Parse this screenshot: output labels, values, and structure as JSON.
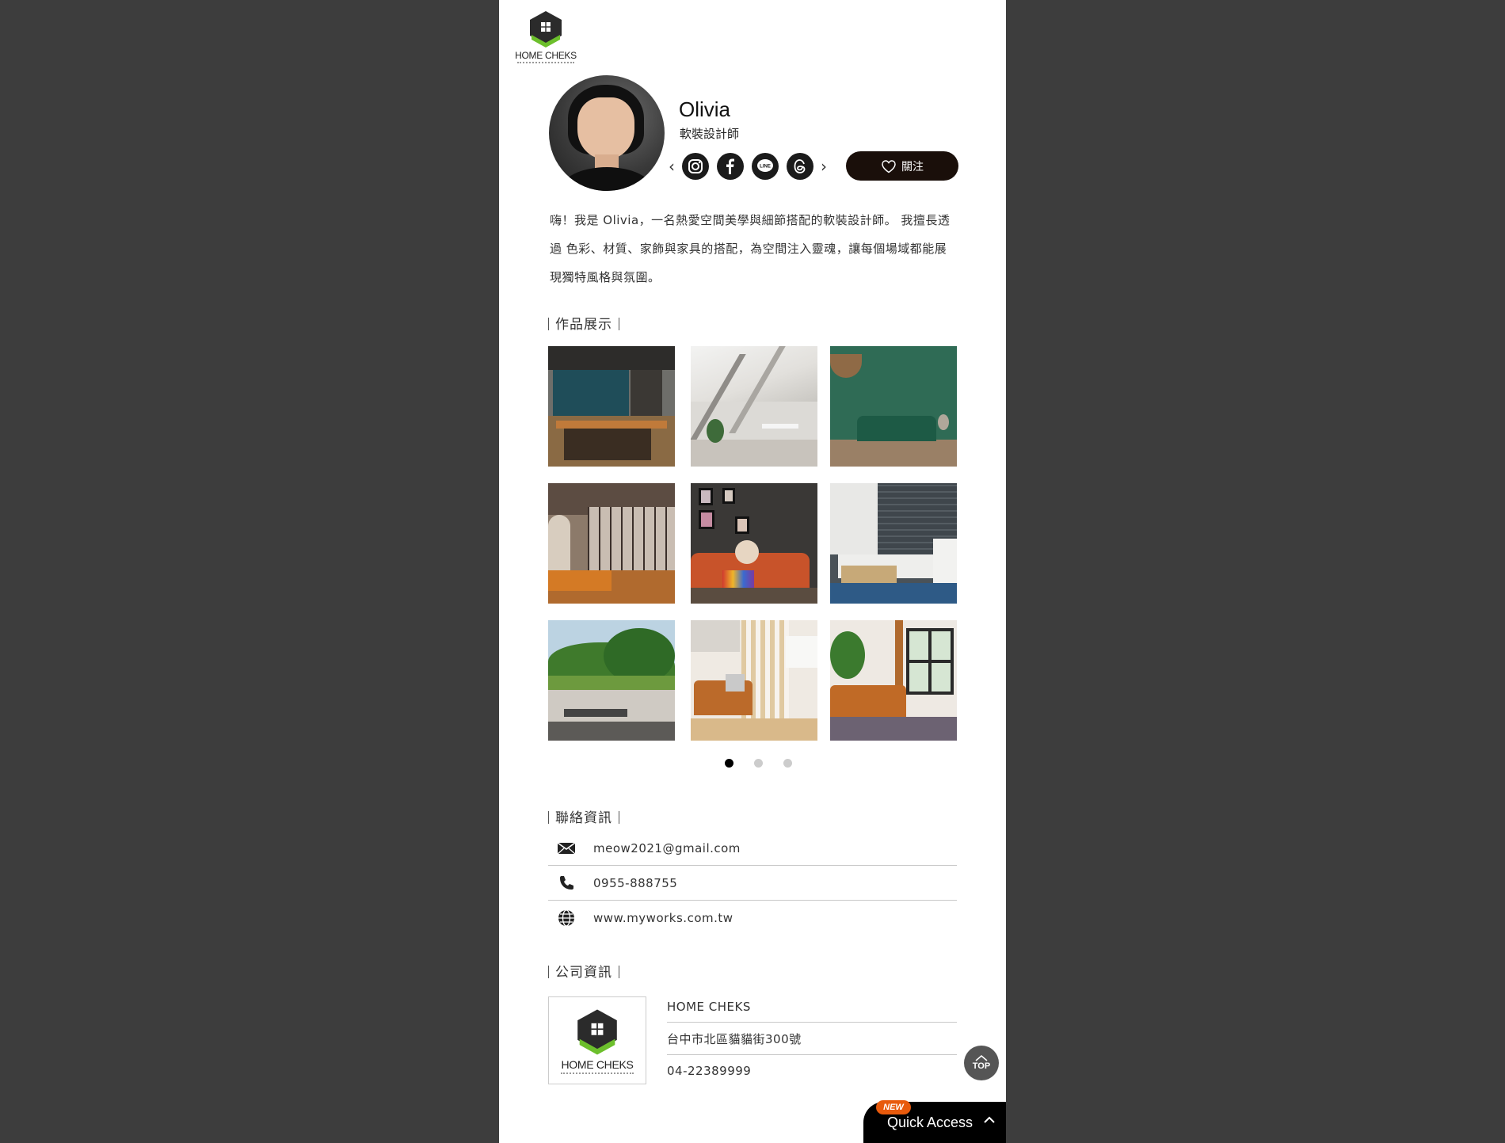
{
  "logo": {
    "brand": "HOME CHEKS"
  },
  "profile": {
    "name": "Olivia",
    "title": "軟裝設計師",
    "follow_label": "關注",
    "social_icons": [
      "instagram-icon",
      "facebook-icon",
      "line-icon",
      "threads-icon"
    ],
    "intro": "嗨！我是 Olivia，一名熱愛空間美學與細節搭配的軟裝設計師。 我擅長透過 色彩、材質、家飾與家具的搭配，為空間注入靈魂，讓每個場域都能展現獨特風格與氛圍。"
  },
  "works": {
    "title": "作品展示",
    "images": [
      "industrial-kitchen",
      "white-attic-study",
      "green-sofa-living",
      "loft-living-orange",
      "dark-wall-orange-sofa",
      "white-sectional-brick",
      "outdoor-grey-sofa",
      "orange-sofa-slats",
      "leather-sofa-window"
    ],
    "pages": 3,
    "active_page": 1
  },
  "contact": {
    "title": "聯絡資訊",
    "email": "meow2021@gmail.com",
    "phone": "0955-888755",
    "website": "www.myworks.com.tw"
  },
  "company": {
    "title": "公司資訊",
    "name": "HOME CHEKS",
    "address": "台中市北區貓貓街300號",
    "phone": "04-22389999",
    "brand": "HOME CHEKS"
  },
  "floating": {
    "top_label": "TOP",
    "quick_access": "Quick Access",
    "new_badge": "NEW"
  },
  "colors": {
    "brand_green": "#6cbf2c",
    "brand_dark": "#2b2b2b",
    "page_bg": "#3d3d3d"
  }
}
